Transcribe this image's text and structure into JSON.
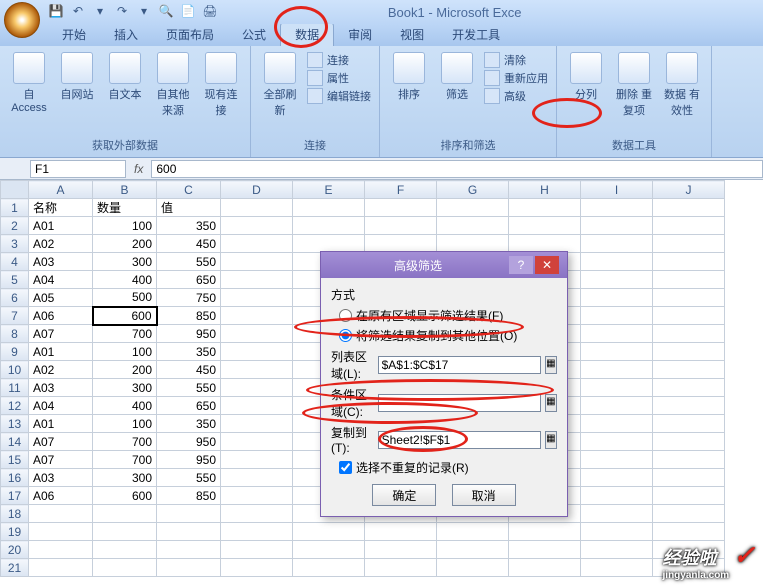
{
  "title": "Book1 - Microsoft Exce",
  "qat_icons": [
    "save-icon",
    "undo-icon",
    "redo-icon",
    "tool-icon",
    "tool2-icon",
    "print-icon"
  ],
  "tabs": [
    "开始",
    "插入",
    "页面布局",
    "公式",
    "数据",
    "审阅",
    "视图",
    "开发工具"
  ],
  "active_tab_index": 4,
  "ribbon": {
    "group1": {
      "label": "获取外部数据",
      "items": [
        "自 Access",
        "自网站",
        "自文本",
        "自其他来源",
        "现有连接"
      ]
    },
    "group2": {
      "label": "连接",
      "big": "全部刷新",
      "small": [
        "连接",
        "属性",
        "编辑链接"
      ]
    },
    "group3": {
      "label": "排序和筛选",
      "items": [
        "排序",
        "筛选"
      ],
      "small": [
        "清除",
        "重新应用",
        "高级"
      ]
    },
    "group4": {
      "label": "数据工具",
      "items": [
        "分列",
        "删除\n重复项",
        "数据\n有效性"
      ]
    }
  },
  "namebox": "F1",
  "formula": "600",
  "columns": [
    "A",
    "B",
    "C",
    "D",
    "E",
    "F",
    "G",
    "H",
    "I",
    "J"
  ],
  "rows": [
    {
      "r": 1,
      "a": "名称",
      "b": "数量",
      "c": "值"
    },
    {
      "r": 2,
      "a": "A01",
      "b": 100,
      "c": 350
    },
    {
      "r": 3,
      "a": "A02",
      "b": 200,
      "c": 450
    },
    {
      "r": 4,
      "a": "A03",
      "b": 300,
      "c": 550
    },
    {
      "r": 5,
      "a": "A04",
      "b": 400,
      "c": 650
    },
    {
      "r": 6,
      "a": "A05",
      "b": 500,
      "c": 750
    },
    {
      "r": 7,
      "a": "A06",
      "b": 600,
      "c": 850
    },
    {
      "r": 8,
      "a": "A07",
      "b": 700,
      "c": 950
    },
    {
      "r": 9,
      "a": "A01",
      "b": 100,
      "c": 350
    },
    {
      "r": 10,
      "a": "A02",
      "b": 200,
      "c": 450
    },
    {
      "r": 11,
      "a": "A03",
      "b": 300,
      "c": 550
    },
    {
      "r": 12,
      "a": "A04",
      "b": 400,
      "c": 650
    },
    {
      "r": 13,
      "a": "A01",
      "b": 100,
      "c": 350
    },
    {
      "r": 14,
      "a": "A07",
      "b": 700,
      "c": 950
    },
    {
      "r": 15,
      "a": "A07",
      "b": 700,
      "c": 950
    },
    {
      "r": 16,
      "a": "A03",
      "b": 300,
      "c": 550
    },
    {
      "r": 17,
      "a": "A06",
      "b": 600,
      "c": 850
    }
  ],
  "empty_rows": [
    18,
    19,
    20,
    21
  ],
  "selected_cell": {
    "row": 7,
    "col": "B"
  },
  "dialog": {
    "title": "高级筛选",
    "method_label": "方式",
    "radio1": "在原有区域显示筛选结果(F)",
    "radio2": "将筛选结果复制到其他位置(O)",
    "radio_selected": 2,
    "list_label": "列表区域(L):",
    "list_value": "$A$1:$C$17",
    "cond_label": "条件区域(C):",
    "cond_value": "",
    "copy_label": "复制到(T):",
    "copy_value": "Sheet2!$F$1",
    "unique_label": "选择不重复的记录(R)",
    "unique_checked": true,
    "ok": "确定",
    "cancel": "取消"
  },
  "watermark": {
    "brand": "经验啦",
    "url": "jingyanla.com"
  }
}
